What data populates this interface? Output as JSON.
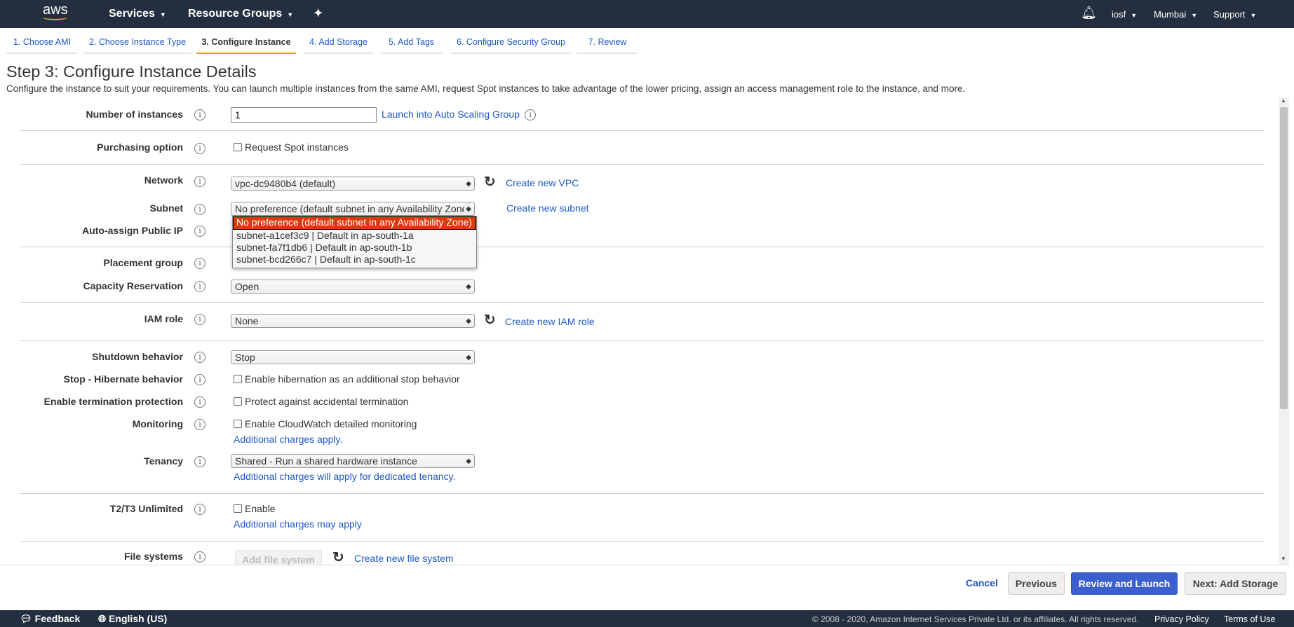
{
  "topnav": {
    "logo": "aws",
    "services": "Services",
    "resource_groups": "Resource Groups",
    "user": "iosf",
    "region": "Mumbai",
    "support": "Support"
  },
  "tabs": [
    {
      "label": "1. Choose AMI"
    },
    {
      "label": "2. Choose Instance Type"
    },
    {
      "label": "3. Configure Instance"
    },
    {
      "label": "4. Add Storage"
    },
    {
      "label": "5. Add Tags"
    },
    {
      "label": "6. Configure Security Group"
    },
    {
      "label": "7. Review"
    }
  ],
  "page": {
    "title": "Step 3: Configure Instance Details",
    "description": "Configure the instance to suit your requirements. You can launch multiple instances from the same AMI, request Spot instances to take advantage of the lower pricing, assign an access management role to the instance, and more."
  },
  "form": {
    "num_instances": {
      "label": "Number of instances",
      "value": "1",
      "link": "Launch into Auto Scaling Group"
    },
    "purchasing": {
      "label": "Purchasing option",
      "checkbox": "Request Spot instances"
    },
    "network": {
      "label": "Network",
      "value": "vpc-dc9480b4 (default)",
      "link": "Create new VPC"
    },
    "subnet": {
      "label": "Subnet",
      "value": "No preference (default subnet in any Availability Zone)",
      "link": "Create new subnet",
      "options": [
        "No preference (default subnet in any Availability Zone)",
        "subnet-a1cef3c9 | Default in ap-south-1a",
        "subnet-fa7f1db6 | Default in ap-south-1b",
        "subnet-bcd266c7 | Default in ap-south-1c"
      ]
    },
    "public_ip": {
      "label": "Auto-assign Public IP"
    },
    "placement": {
      "label": "Placement group"
    },
    "capacity": {
      "label": "Capacity Reservation",
      "value": "Open"
    },
    "iam": {
      "label": "IAM role",
      "value": "None",
      "link": "Create new IAM role"
    },
    "shutdown": {
      "label": "Shutdown behavior",
      "value": "Stop"
    },
    "hibernate": {
      "label": "Stop - Hibernate behavior",
      "checkbox": "Enable hibernation as an additional stop behavior"
    },
    "termination": {
      "label": "Enable termination protection",
      "checkbox": "Protect against accidental termination"
    },
    "monitoring": {
      "label": "Monitoring",
      "checkbox": "Enable CloudWatch detailed monitoring",
      "link": "Additional charges apply."
    },
    "tenancy": {
      "label": "Tenancy",
      "value": "Shared - Run a shared hardware instance",
      "link": "Additional charges will apply for dedicated tenancy."
    },
    "unlimited": {
      "label": "T2/T3 Unlimited",
      "checkbox": "Enable",
      "link": "Additional charges may apply"
    },
    "filesystems": {
      "label": "File systems",
      "button": "Add file system",
      "link": "Create new file system"
    }
  },
  "actions": {
    "cancel": "Cancel",
    "previous": "Previous",
    "review": "Review and Launch",
    "next": "Next: Add Storage"
  },
  "footer": {
    "feedback": "Feedback",
    "language": "English (US)",
    "copyright": "© 2008 - 2020, Amazon Internet Services Private Ltd. or its affiliates. All rights reserved.",
    "privacy": "Privacy Policy",
    "terms": "Terms of Use"
  },
  "colors": {
    "nav_bg": "#232f3e",
    "accent_orange": "#f49c1c",
    "link": "#1f58c7",
    "primary_button": "#3b5fcf",
    "selected_option": "#d93a0b"
  }
}
